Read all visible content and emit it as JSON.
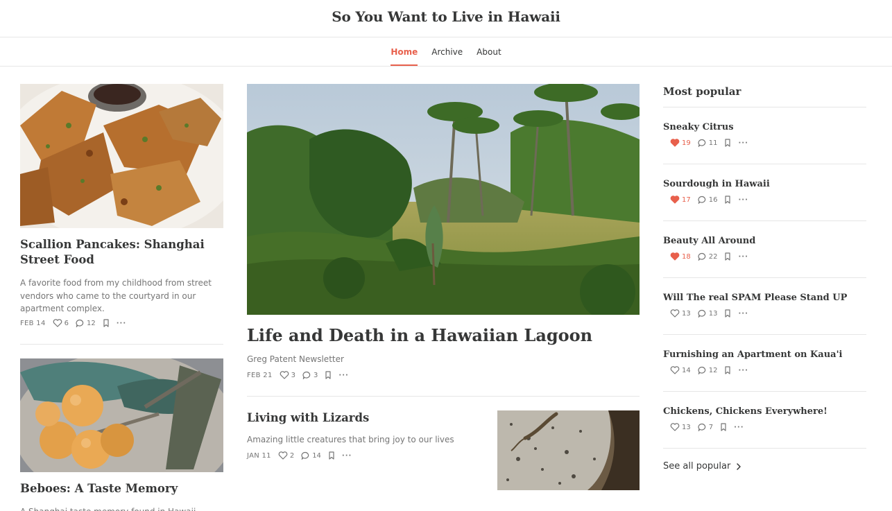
{
  "site": {
    "title": "So You Want to Live in Hawaii"
  },
  "nav": {
    "items": [
      "Home",
      "Archive",
      "About"
    ],
    "active": "Home"
  },
  "accent_color": "#e8604c",
  "left_posts": [
    {
      "title": "Scallion Pancakes: Shanghai Street Food",
      "subtitle": "A favorite food from my childhood from street vendors who came to the courtyard in our apartment complex.",
      "date": "FEB 14",
      "likes": "6",
      "comments": "12"
    },
    {
      "title": "Beboes: A Taste Memory",
      "subtitle": "A Shanghai taste memory found in Hawaii"
    }
  ],
  "featured": {
    "title": "Life and Death in a Hawaiian Lagoon",
    "author": "Greg Patent Newsletter",
    "date": "FEB 21",
    "likes": "3",
    "comments": "3"
  },
  "secondary_post": {
    "title": "Living with Lizards",
    "subtitle": "Amazing little creatures that bring joy to our lives",
    "date": "JAN 11",
    "likes": "2",
    "comments": "14"
  },
  "popular": {
    "heading": "Most popular",
    "items": [
      {
        "title": "Sneaky Citrus",
        "likes": "19",
        "comments": "11",
        "liked": true
      },
      {
        "title": "Sourdough in Hawaii",
        "likes": "17",
        "comments": "16",
        "liked": true
      },
      {
        "title": "Beauty All Around",
        "likes": "18",
        "comments": "22",
        "liked": true
      },
      {
        "title": "Will The real SPAM Please Stand UP",
        "likes": "13",
        "comments": "13",
        "liked": false
      },
      {
        "title": "Furnishing an Apartment on Kaua'i",
        "likes": "14",
        "comments": "12",
        "liked": false
      },
      {
        "title": "Chickens, Chickens Everywhere!",
        "likes": "13",
        "comments": "7",
        "liked": false
      }
    ],
    "see_all": "See all popular"
  }
}
